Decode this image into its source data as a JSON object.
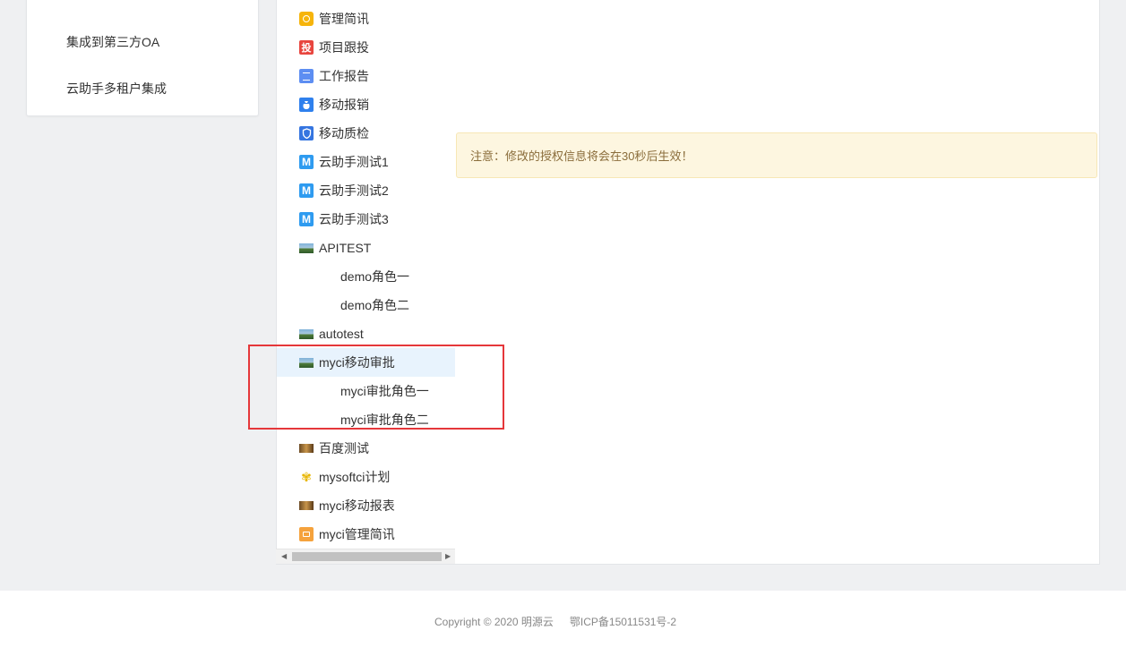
{
  "left_menu": {
    "items": [
      {
        "label": "集成到第三方OA"
      },
      {
        "label": "云助手多租户集成"
      }
    ]
  },
  "tree": {
    "items": [
      {
        "label": "管理简讯",
        "icon": "sun-app-icon"
      },
      {
        "label": "项目跟投",
        "icon": "tou-app-icon"
      },
      {
        "label": "工作报告",
        "icon": "document-app-icon"
      },
      {
        "label": "移动报销",
        "icon": "moneybag-app-icon"
      },
      {
        "label": "移动质检",
        "icon": "shield-app-icon"
      },
      {
        "label": "云助手测试1",
        "icon": "m-app-icon"
      },
      {
        "label": "云助手测试2",
        "icon": "m-app-icon"
      },
      {
        "label": "云助手测试3",
        "icon": "m-app-icon"
      },
      {
        "label": "APITEST",
        "icon": "landscape-app-icon"
      },
      {
        "label": "demo角色一"
      },
      {
        "label": "demo角色二"
      },
      {
        "label": "autotest",
        "icon": "landscape-app-icon"
      },
      {
        "label": "myci移动审批",
        "icon": "landscape-app-icon",
        "selected": true
      },
      {
        "label": "myci审批角色一"
      },
      {
        "label": "myci审批角色二"
      },
      {
        "label": "百度测试",
        "icon": "film-app-icon"
      },
      {
        "label": "mysoftci计划",
        "icon": "flower-app-icon"
      },
      {
        "label": "myci移动报表",
        "icon": "film-app-icon"
      },
      {
        "label": "myci管理简讯",
        "icon": "calendar-app-icon"
      }
    ]
  },
  "notice": {
    "text": "注意：修改的授权信息将会在30秒后生效！"
  },
  "footer": {
    "copyright": "Copyright © 2020 明源云",
    "icp": "鄂ICP备15011531号-2"
  },
  "colors": {
    "highlight": "#e5373a",
    "selected_bg": "#e8f3fd",
    "notice_bg": "#fdf6e0"
  }
}
